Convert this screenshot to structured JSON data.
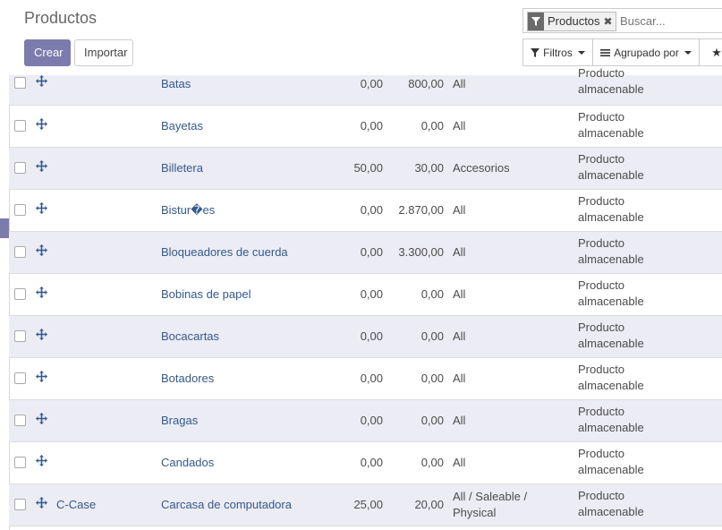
{
  "header": {
    "title": "Productos",
    "create_label": "Crear",
    "import_label": "Importar"
  },
  "search": {
    "facet_label": "Productos",
    "placeholder": "Buscar..."
  },
  "toolbar": {
    "filters_label": "Filtros",
    "groupby_label": "Agrupado por"
  },
  "rows": [
    {
      "ref": "",
      "name": "Batas",
      "sale": "0,00",
      "cost": "800,00",
      "category": "All",
      "type1": "Producto",
      "type2": "almacenable"
    },
    {
      "ref": "",
      "name": "Bayetas",
      "sale": "0,00",
      "cost": "0,00",
      "category": "All",
      "type1": "Producto",
      "type2": "almacenable"
    },
    {
      "ref": "",
      "name": "Billetera",
      "sale": "50,00",
      "cost": "30,00",
      "category": "Accesorios",
      "type1": "Producto",
      "type2": "almacenable"
    },
    {
      "ref": "",
      "name": "Bistur�es",
      "sale": "0,00",
      "cost": "2.870,00",
      "category": "All",
      "type1": "Producto",
      "type2": "almacenable"
    },
    {
      "ref": "",
      "name": "Bloqueadores de cuerda",
      "sale": "0,00",
      "cost": "3.300,00",
      "category": "All",
      "type1": "Producto",
      "type2": "almacenable"
    },
    {
      "ref": "",
      "name": "Bobinas de papel",
      "sale": "0,00",
      "cost": "0,00",
      "category": "All",
      "type1": "Producto",
      "type2": "almacenable"
    },
    {
      "ref": "",
      "name": "Bocacartas",
      "sale": "0,00",
      "cost": "0,00",
      "category": "All",
      "type1": "Producto",
      "type2": "almacenable"
    },
    {
      "ref": "",
      "name": "Botadores",
      "sale": "0,00",
      "cost": "0,00",
      "category": "All",
      "type1": "Producto",
      "type2": "almacenable"
    },
    {
      "ref": "",
      "name": "Bragas",
      "sale": "0,00",
      "cost": "0,00",
      "category": "All",
      "type1": "Producto",
      "type2": "almacenable"
    },
    {
      "ref": "",
      "name": "Candados",
      "sale": "0,00",
      "cost": "0,00",
      "category": "All",
      "type1": "Producto",
      "type2": "almacenable"
    },
    {
      "ref": "C-Case",
      "name": "Carcasa de computadora",
      "sale": "25,00",
      "cost": "20,00",
      "category": "All / Saleable /",
      "category2": "Physical",
      "type1": "Producto",
      "type2": "almacenable"
    }
  ],
  "colors": {
    "primary": "#7c7bad",
    "link": "#34598c",
    "row_alt": "#ececf5"
  }
}
